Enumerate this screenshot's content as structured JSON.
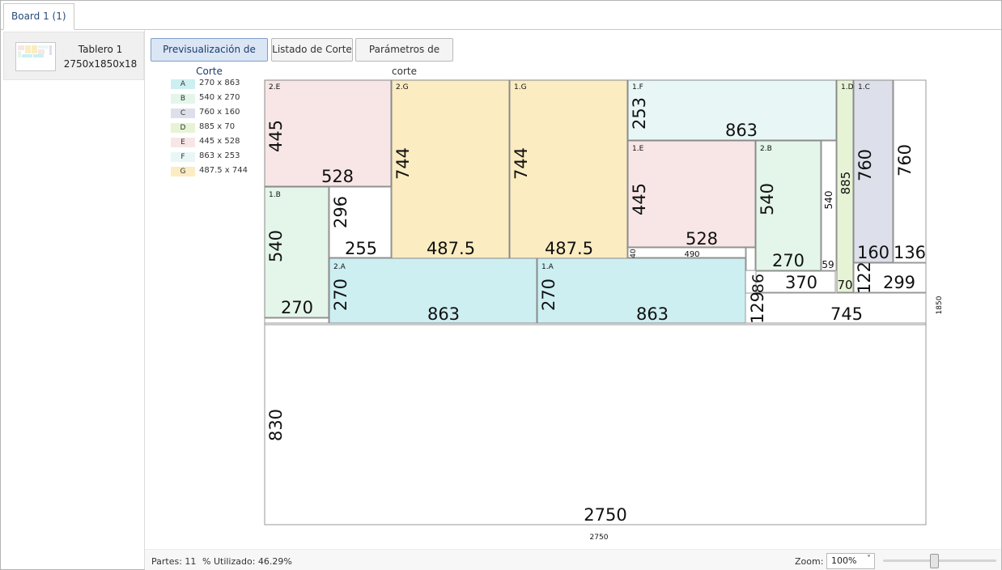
{
  "tab": {
    "label": "Board 1 (1)"
  },
  "sidebar": {
    "items": [
      {
        "name": "Tablero 1",
        "dims": "2750x1850x18"
      }
    ]
  },
  "toolbar": {
    "preview_label": "Previsualización de Corte",
    "list_label": "Listado de Corte",
    "params_label": "Parámetros de corte"
  },
  "colors": {
    "A": "#cdeff2",
    "B": "#e4f5ea",
    "C": "#dde0ea",
    "D": "#e7f3d5",
    "E": "#f8e6e7",
    "F": "#e8f7f6",
    "G": "#fbecc1"
  },
  "legend": [
    {
      "key": "A",
      "text": "270 x 863"
    },
    {
      "key": "B",
      "text": "540 x 270"
    },
    {
      "key": "C",
      "text": "760 x 160"
    },
    {
      "key": "D",
      "text": "885 x 70"
    },
    {
      "key": "E",
      "text": "445 x 528"
    },
    {
      "key": "F",
      "text": "863 x 253"
    },
    {
      "key": "G",
      "text": "487.5 x 744"
    }
  ],
  "board": {
    "width": 2750,
    "height": 1850,
    "width_label": "2750",
    "height_label": "1850"
  },
  "pieces": [
    {
      "id": "2.E",
      "code": "E",
      "w": "528",
      "h": "445"
    },
    {
      "id": "2.G",
      "code": "G",
      "w": "487.5",
      "h": "744"
    },
    {
      "id": "1.G",
      "code": "G",
      "w": "487.5",
      "h": "744"
    },
    {
      "id": "1.F",
      "code": "F",
      "w": "863",
      "h": "253"
    },
    {
      "id": "1.E",
      "code": "E",
      "w": "528",
      "h": "445"
    },
    {
      "id": "2.B",
      "code": "B",
      "w": "270",
      "h": "540"
    },
    {
      "id": "1.D",
      "code": "D",
      "w": "70",
      "h": "885"
    },
    {
      "id": "1.C",
      "code": "C",
      "w": "160",
      "h": "760"
    },
    {
      "id": "1.B",
      "code": "B",
      "w": "270",
      "h": "540"
    },
    {
      "id": "2.A",
      "code": "A",
      "w": "863",
      "h": "270"
    },
    {
      "id": "1.A",
      "code": "A",
      "w": "863",
      "h": "270"
    }
  ],
  "waste": [
    {
      "w": "255",
      "h": "296"
    },
    {
      "w": "136",
      "h": "760"
    },
    {
      "w": "490",
      "h": "40"
    },
    {
      "w": "59",
      "h": "540"
    },
    {
      "w": "370",
      "h": "86"
    },
    {
      "w": "299",
      "h": "122"
    },
    {
      "w": "745",
      "h": "129"
    },
    {
      "w": "2750",
      "h": "830"
    }
  ],
  "status": {
    "parts": "Partes: 11",
    "used": "% Utilizado: 46.29%",
    "zoom_label": "Zoom:",
    "zoom_value": "100%"
  }
}
